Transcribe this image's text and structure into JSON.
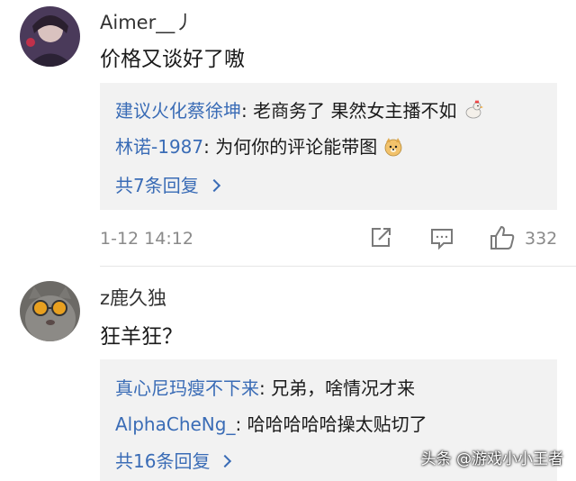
{
  "comments": [
    {
      "username": "Aimer__丿",
      "text": "价格又谈好了嗷",
      "replies": [
        {
          "author": "建议火化蔡徐坤",
          "sep": ": ",
          "text": "老商务了 果然女主播不如",
          "emoji": "rooster"
        },
        {
          "author": "林诺-1987",
          "sep": ": ",
          "text": "为何你的评论能带图",
          "emoji": "doge"
        }
      ],
      "more_replies": "共7条回复",
      "timestamp": "1-12 14:12",
      "like_count": "332"
    },
    {
      "username": "z鹿久独",
      "text": "狂羊狂？",
      "replies": [
        {
          "author": "真心尼玛瘦不下来",
          "sep": ": ",
          "text": "兄弟，啥情况才来"
        },
        {
          "author": "AlphaCheNg_",
          "sep": ": ",
          "text": "哈哈哈哈哈操太贴切了"
        }
      ],
      "more_replies": "共16条回复"
    }
  ],
  "watermark": "头条 @游戏小小王者",
  "colors": {
    "link": "#3a6cb6",
    "reply_bg": "#f2f2f2",
    "meta": "#8a8a8a"
  },
  "icons": [
    "share-icon",
    "comment-icon",
    "like-icon"
  ]
}
